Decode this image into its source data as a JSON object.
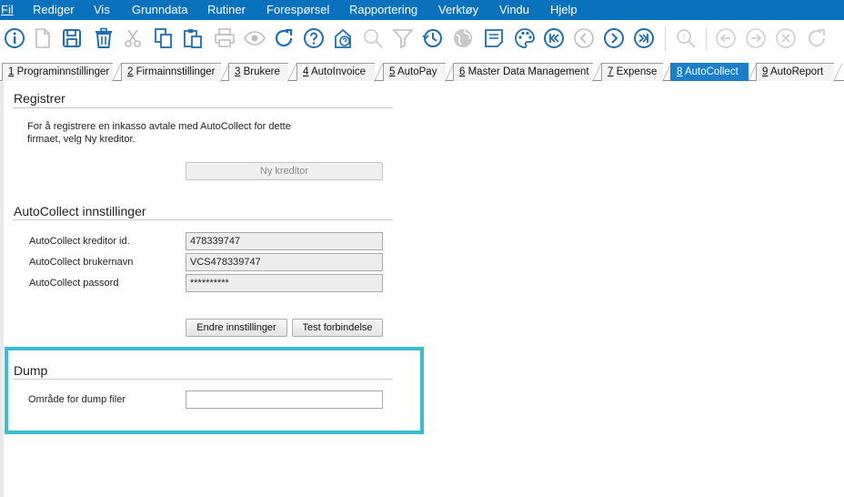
{
  "menu": [
    {
      "label": "Fil",
      "id": "fil"
    },
    {
      "label": "Rediger",
      "id": "rediger"
    },
    {
      "label": "Vis",
      "id": "vis"
    },
    {
      "label": "Grunndata",
      "id": "grunndata"
    },
    {
      "label": "Rutiner",
      "id": "rutiner"
    },
    {
      "label": "Forespørsel",
      "id": "forespoersel"
    },
    {
      "label": "Rapportering",
      "id": "rapportering"
    },
    {
      "label": "Verktøy",
      "id": "verktoy"
    },
    {
      "label": "Vindu",
      "id": "vindu"
    },
    {
      "label": "Hjelp",
      "id": "hjelp"
    }
  ],
  "toolbar_icons": [
    "info-icon",
    "new-document-icon",
    "save-icon",
    "delete-icon",
    "cut-icon",
    "copy-icon",
    "paste-icon",
    "print-icon",
    "preview-icon",
    "refresh-icon",
    "help-icon",
    "help-document-icon",
    "search-icon",
    "filter-icon",
    "history-icon",
    "globe-icon",
    "notes-icon",
    "palette-icon",
    "first-record-icon",
    "previous-record-icon",
    "next-record-icon",
    "last-record-icon",
    "zoom-icon",
    "back-icon",
    "forward-icon",
    "cancel-icon",
    "redo-icon"
  ],
  "tabs": [
    {
      "num": "1",
      "label": " Programinnstillinger"
    },
    {
      "num": "2",
      "label": " Firmainnstillinger"
    },
    {
      "num": "3",
      "label": " Brukere"
    },
    {
      "num": "4",
      "label": " AutoInvoice"
    },
    {
      "num": "5",
      "label": " AutoPay"
    },
    {
      "num": "6",
      "label": " Master Data Management"
    },
    {
      "num": "7",
      "label": " Expense"
    },
    {
      "num": "8",
      "label": " AutoCollect"
    },
    {
      "num": "9",
      "label": " AutoReport"
    }
  ],
  "active_tab": "8",
  "registrer": {
    "title": "Registrer",
    "description_line1": "For å registrere en inkasso avtale med AutoCollect for dette",
    "description_line2": "firmaet, velg Ny kreditor.",
    "button": "Ny kreditor"
  },
  "settings": {
    "title": "AutoCollect innstillinger",
    "creditor_label": "AutoCollect kreditor id.",
    "creditor_value": "478339747",
    "username_label": "AutoCollect brukernavn",
    "username_value": "VCS478339747",
    "password_label": "AutoCollect passord",
    "password_value": "**********",
    "change_button": "Endre  innstillinger",
    "test_button": "Test forbindelse"
  },
  "dump": {
    "title": "Dump",
    "label": "Område for dump filer",
    "value": ""
  },
  "colors": {
    "menubar": "#0a72bd",
    "active_tab": "#1a7fc8",
    "highlight": "#3bbcd6",
    "icon_blue": "#1a6fb5"
  }
}
